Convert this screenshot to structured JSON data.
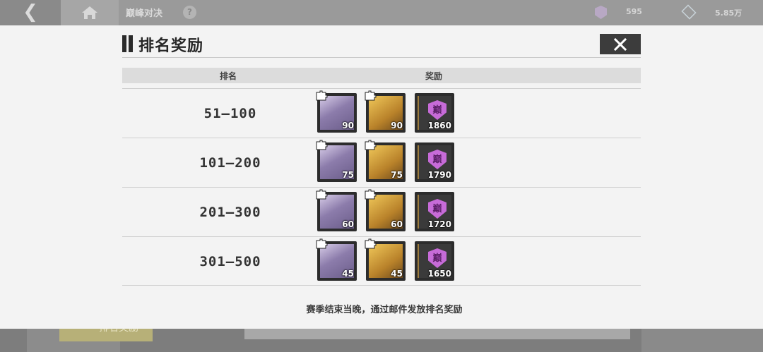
{
  "background": {
    "topbar": {
      "back_glyph": "❮",
      "home_icon": "house-icon",
      "title": "巅峰对决",
      "help_glyph": "?",
      "currency_1": {
        "icon": "badge-icon",
        "value": "595"
      },
      "currency_2": {
        "icon": "diamond-icon",
        "value": "5.85万"
      }
    },
    "left_panel": {
      "button_label": "排名奖励"
    }
  },
  "modal": {
    "title": "排名奖励",
    "close_icon": "close-icon",
    "columns": {
      "rank": "排名",
      "reward": "奖励"
    },
    "rows": [
      {
        "rank": "51—100",
        "rewards": [
          {
            "type": "card",
            "count": "90"
          },
          {
            "type": "box",
            "count": "90"
          },
          {
            "type": "coin",
            "count": "1860"
          }
        ]
      },
      {
        "rank": "101—200",
        "rewards": [
          {
            "type": "card",
            "count": "75"
          },
          {
            "type": "box",
            "count": "75"
          },
          {
            "type": "coin",
            "count": "1790"
          }
        ]
      },
      {
        "rank": "201—300",
        "rewards": [
          {
            "type": "card",
            "count": "60"
          },
          {
            "type": "box",
            "count": "60"
          },
          {
            "type": "coin",
            "count": "1720"
          }
        ]
      },
      {
        "rank": "301—500",
        "rewards": [
          {
            "type": "card",
            "count": "45"
          },
          {
            "type": "box",
            "count": "45"
          },
          {
            "type": "coin",
            "count": "1650"
          }
        ]
      }
    ],
    "coin_glyph": "巅",
    "footer_note": "赛季结束当晚，通过邮件发放排名奖励"
  },
  "colors": {
    "overlay": "#f3f3f3",
    "close_bg": "#3c3c3c",
    "coin_shield": "#c76bd8",
    "gold_box": "#d9a63b",
    "card_purple": "#8c7cab"
  }
}
